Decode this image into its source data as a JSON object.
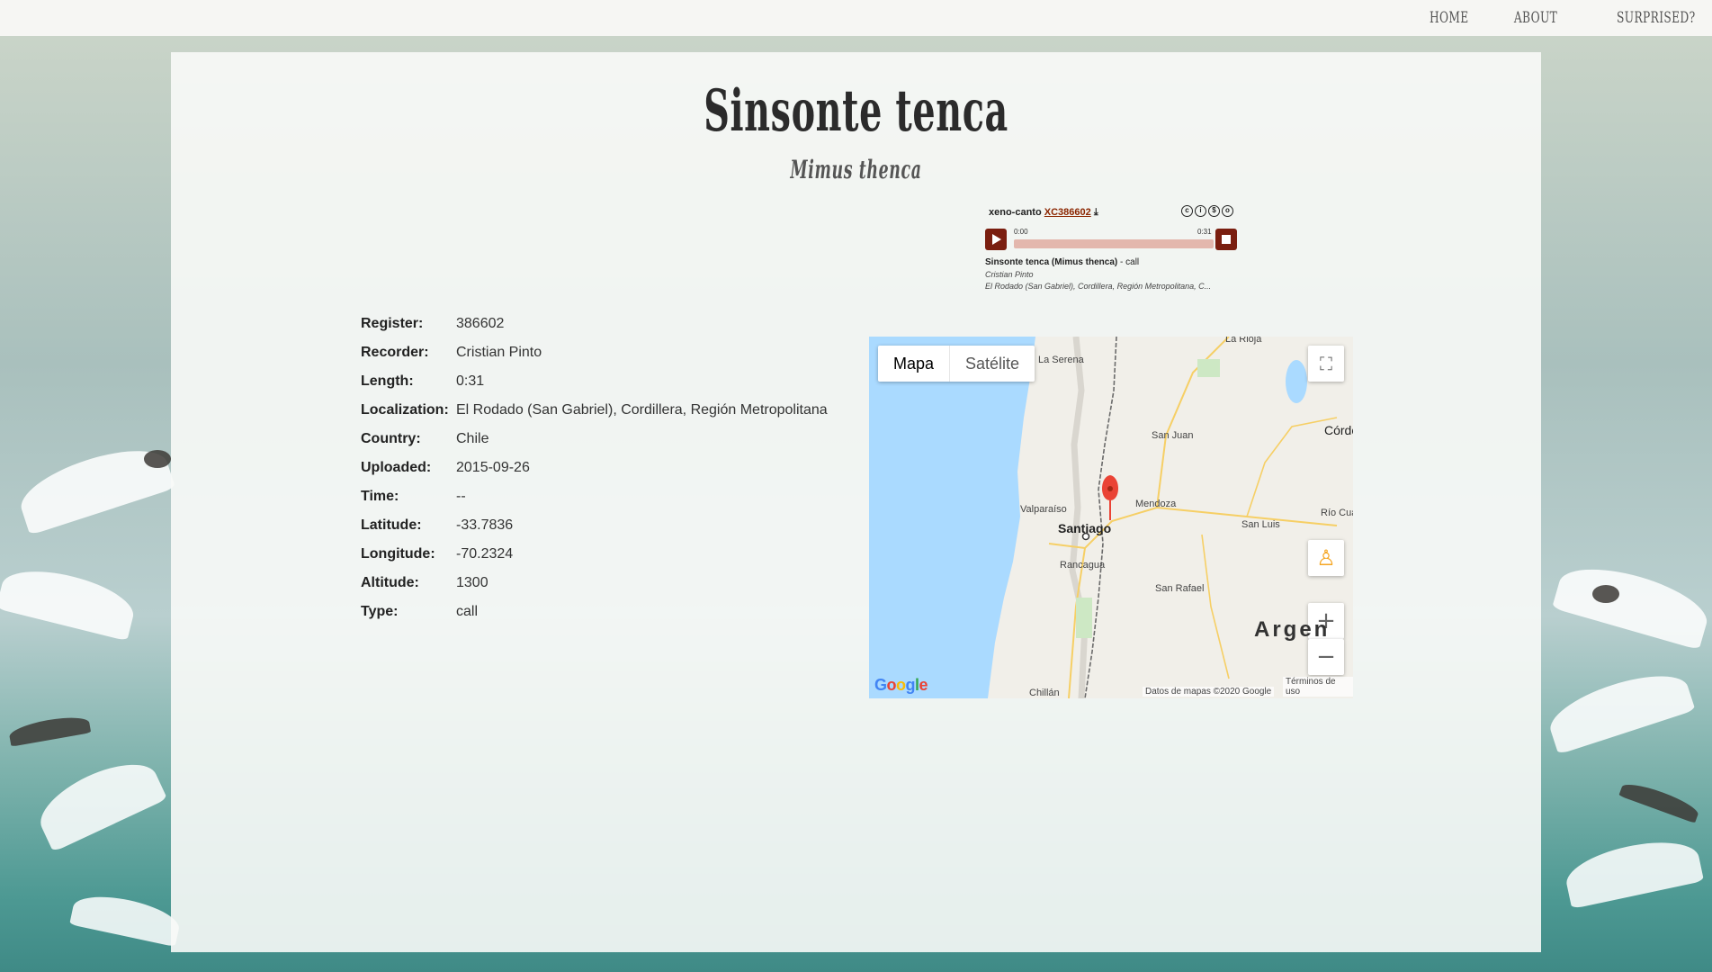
{
  "nav": {
    "home": "HOME",
    "about": "ABOUT",
    "surprised": "SURPRISED?"
  },
  "species": {
    "common_name": "Sinsonte tenca",
    "scientific_name": "Mimus thenca"
  },
  "player": {
    "brand": "xeno-canto",
    "catalog": "XC386602",
    "time_start": "0:00",
    "time_end": "0:31",
    "progress": 0,
    "title": "Sinsonte tenca (Mimus thenca)",
    "type_suffix": " - call",
    "recordist": "Cristian Pinto",
    "location": "El Rodado (San Gabriel), Cordillera, Región Metropolitana, C...",
    "accent_color": "#7a1e0f"
  },
  "info": [
    {
      "label": "Register:",
      "value": "386602"
    },
    {
      "label": "Recorder:",
      "value": "Cristian Pinto"
    },
    {
      "label": "Length:",
      "value": "0:31"
    },
    {
      "label": "Localization:",
      "value": "El Rodado (San Gabriel), Cordillera, Región Metropolitana"
    },
    {
      "label": "Country:",
      "value": "Chile"
    },
    {
      "label": "Uploaded:",
      "value": "2015-09-26"
    },
    {
      "label": "Time:",
      "value": "--"
    },
    {
      "label": "Latitude:",
      "value": "-33.7836"
    },
    {
      "label": "Longitude:",
      "value": "-70.2324"
    },
    {
      "label": "Altitude:",
      "value": "1300"
    },
    {
      "label": "Type:",
      "value": "call"
    }
  ],
  "map": {
    "type_map": "Mapa",
    "type_satellite": "Satélite",
    "cities": {
      "la_serena": "La Serena",
      "la_rioja": "La Rioja",
      "cordoba": "Córdo",
      "san_juan": "San Juan",
      "valparaiso": "Valparaíso",
      "santiago": "Santiago",
      "mendoza": "Mendoza",
      "san_luis": "San Luis",
      "rio_cuarto": "Río Cua",
      "rancagua": "Rancagua",
      "san_rafael": "San Rafael",
      "chillan": "Chillán"
    },
    "country_label": "Argen",
    "country_label_tail": "n",
    "google": "Google",
    "attribution": "Datos de mapas ©2020 Google",
    "terms": "Términos de uso",
    "water_color": "#aadaff",
    "marker_color": "#ea4335"
  }
}
